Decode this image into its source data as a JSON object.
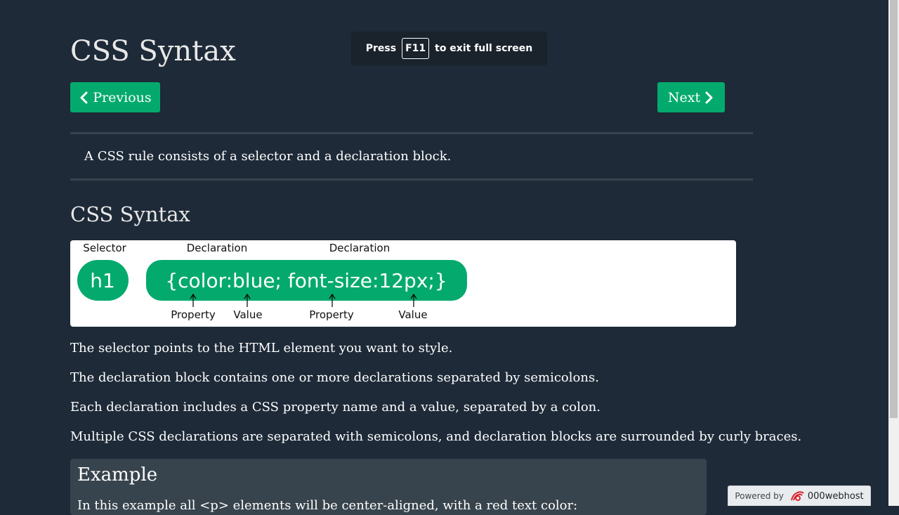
{
  "header": {
    "title": "CSS Syntax"
  },
  "nav": {
    "prev_label": "Previous",
    "next_label": "Next"
  },
  "intro": "A CSS rule consists of a selector and a declaration block.",
  "section": {
    "title": "CSS Syntax"
  },
  "diagram": {
    "top_labels": [
      "Selector",
      "Declaration",
      "Declaration"
    ],
    "selector": "h1",
    "block": "{color:blue; font-size:12px;}",
    "bottom_labels": [
      "Property",
      "Value",
      "Property",
      "Value"
    ],
    "accent": "#04aa6d"
  },
  "paragraphs": [
    "The selector points to the HTML element you want to style.",
    "The declaration block contains one or more declarations separated by semicolons.",
    "Each declaration includes a CSS property name and a value, separated by a colon.",
    "Multiple CSS declarations are separated with semicolons, and declaration blocks are surrounded by curly braces."
  ],
  "example": {
    "title": "Example",
    "text": "In this example all <p> elements will be center-aligned, with a red text color:"
  },
  "fullscreen_toast": {
    "before": "Press",
    "key": "F11",
    "after": "to exit full screen"
  },
  "powered_by": {
    "label": "Powered by",
    "brand": "000webhost",
    "icon": "000webhost-logo-icon"
  },
  "colors": {
    "background": "#1e2a38",
    "accent": "#04aa6d",
    "rule": "#38444d",
    "example_bg": "#38444d"
  }
}
